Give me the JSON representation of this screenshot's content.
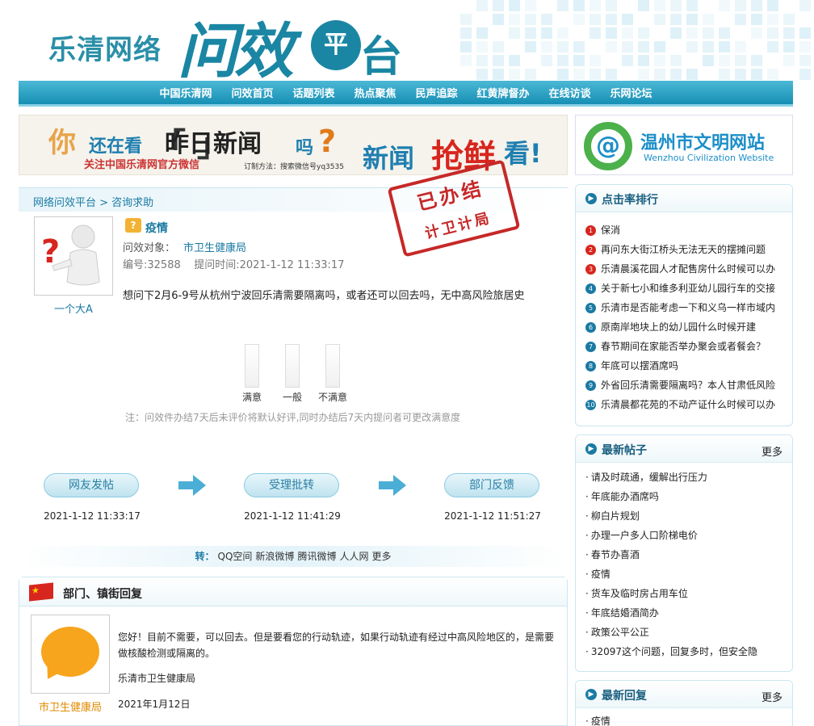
{
  "header": {
    "logo_small": "乐清网络",
    "logo_big": "问效",
    "logo_ping": "平",
    "logo_tai": "台"
  },
  "nav": {
    "items": [
      "中国乐清网",
      "问效首页",
      "话题列表",
      "热点聚焦",
      "民声追踪",
      "红黄牌督办",
      "在线访谈",
      "乐网论坛"
    ]
  },
  "banner": {
    "ni": "你",
    "hai": "还在看",
    "brk": "「    」",
    "zuori": "昨日新闻",
    "ma": "吗",
    "q": "?",
    "follow": "关注中国乐清网官方微信",
    "order": "订制方法：搜索微信号yq3535",
    "xinwen": "新闻",
    "qiang": "抢鲜",
    "kan": "看!"
  },
  "wenming": {
    "cn": "温州市文明网站",
    "en": "Wenzhou Civilization Website"
  },
  "breadcrumb": "网络问效平台 > 咨询求助",
  "stamp": {
    "line1": "已办结",
    "line2": "计卫计局"
  },
  "question": {
    "user": "一个大A",
    "icon": "?",
    "title": "疫情",
    "target_label": "问效对象：",
    "target_value": "市卫生健康局",
    "meta": "编号:32588    提问时间:2021-1-12 11:33:17",
    "body": "想问下2月6-9号从杭州宁波回乐清需要隔离吗，或者还可以回去吗，无中高风险旅居史"
  },
  "vote": {
    "labels": [
      "满意",
      "一般",
      "不满意"
    ],
    "note": "注：问效件办结7天后未评价将默认好评,同时办结后7天内提问者可更改满意度"
  },
  "steps": [
    {
      "label": "网友发帖",
      "time": "2021-1-12 11:33:17"
    },
    {
      "label": "受理批转",
      "time": "2021-1-12 11:41:29"
    },
    {
      "label": "部门反馈",
      "time": "2021-1-12 11:51:27"
    }
  ],
  "share": {
    "label": "转：",
    "links": [
      "QQ空间",
      "新浪微博",
      "腾讯微博",
      "人人网",
      "更多"
    ]
  },
  "reply": {
    "title": "部门、镇街回复",
    "dept": "市卫生健康局",
    "text": "您好！目前不需要，可以回去。但是要看您的行动轨迹，如果行动轨迹有经过中高风险地区的，是需要做核酸检测或隔离的。",
    "signature": "乐清市卫生健康局",
    "date": "2021年1月12日"
  },
  "sidebar": {
    "rank": {
      "title": "点击率排行",
      "items": [
        "保消",
        "再问东大街江桥头无法无天的摆摊问题",
        "乐清晨溪花园人才配售房什么时候可以办",
        "关于新七小和维多利亚幼儿园行车的交接",
        "乐清市是否能考虑一下和义乌一样市域内",
        "原南岸地块上的幼儿园什么时候开建",
        "春节期间在家能否举办聚会或者餐会？",
        "年底可以摆酒席吗",
        "外省回乐清需要隔离吗？本人甘肃低风险",
        "乐清晨都花苑的不动产证什么时候可以办"
      ],
      "colors": [
        "#d7261e",
        "#d7261e",
        "#d7261e",
        "#1a7aa3",
        "#1a7aa3",
        "#1a7aa3",
        "#1a7aa3",
        "#1a7aa3",
        "#1a7aa3",
        "#1a7aa3"
      ]
    },
    "latest_posts": {
      "title": "最新帖子",
      "more": "更多",
      "items": [
        "请及时疏通，缓解出行压力",
        "年底能办酒席吗",
        "柳白片规划",
        "办理一户多人口阶梯电价",
        "春节办喜酒",
        "疫情",
        "货车及临时房占用车位",
        "年底结婚酒简办",
        "政策公平公正",
        "32097这个问题，回复多时，但安全隐"
      ]
    },
    "latest_replies": {
      "title": "最新回复",
      "more": "更多",
      "items": [
        "疫情"
      ]
    }
  }
}
